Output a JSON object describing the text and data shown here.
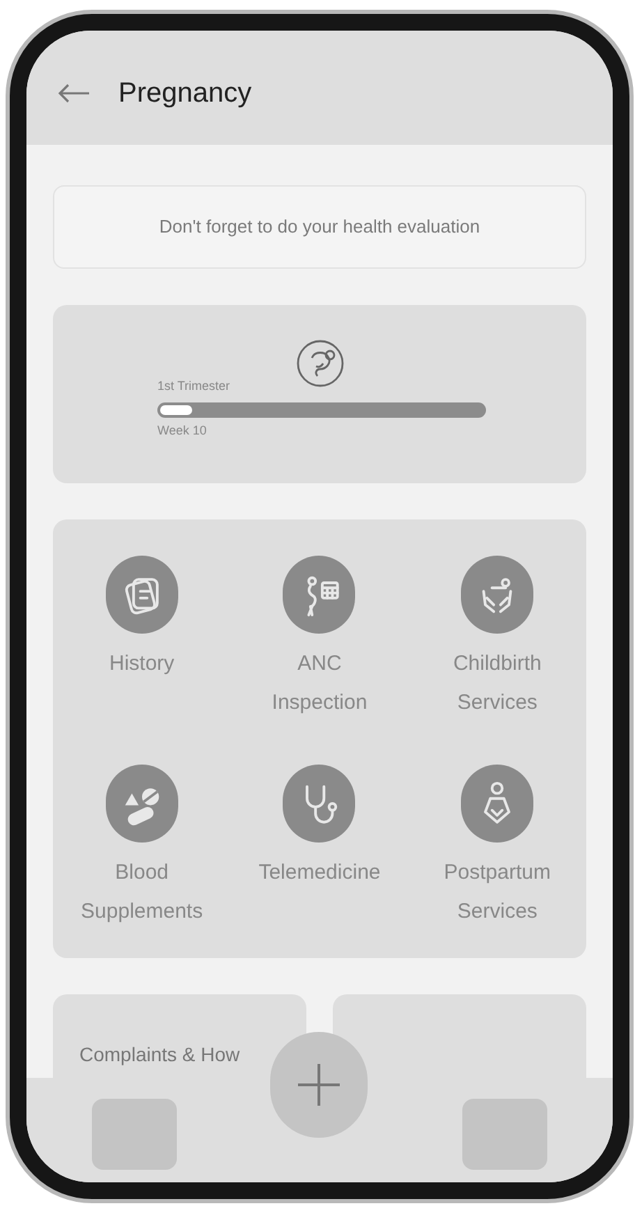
{
  "header": {
    "title": "Pregnancy"
  },
  "reminder": {
    "text": "Don't forget to do your health evaluation"
  },
  "progress": {
    "trimester": "1st Trimester",
    "level": 0.1,
    "week": "Week 10"
  },
  "services": [
    {
      "kind": "history",
      "label": "History"
    },
    {
      "kind": "anc",
      "label": "ANC Inspection"
    },
    {
      "kind": "childbirth",
      "label": "Childbirth Services"
    },
    {
      "kind": "supplements",
      "label": "Blood Supplements"
    },
    {
      "kind": "telemedicine",
      "label": "Telemedicine"
    },
    {
      "kind": "postpartum",
      "label": "Postpartum Services"
    }
  ],
  "bottom_cards": [
    {
      "title": "Complaints & How"
    }
  ]
}
